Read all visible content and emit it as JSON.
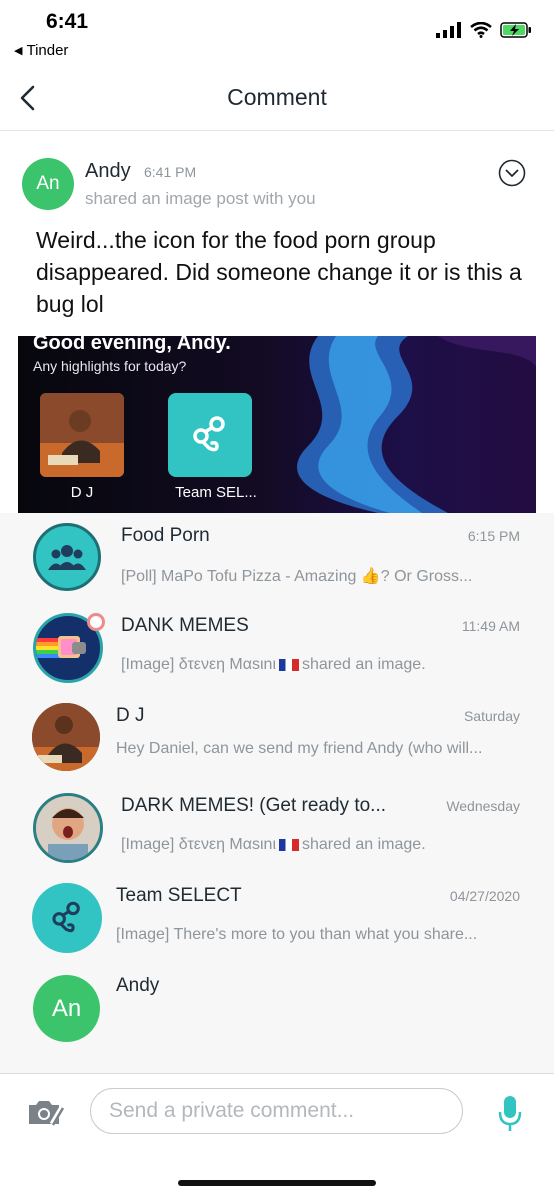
{
  "status_bar": {
    "time": "6:41",
    "back_app": "Tinder"
  },
  "nav": {
    "title": "Comment"
  },
  "post": {
    "avatar_initials": "An",
    "author": "Andy",
    "time": "6:41 PM",
    "subtitle": "shared an image post with you",
    "message": "Weird...the icon for the food porn group disappeared. Did someone change it or is this a bug lol"
  },
  "shared_image": {
    "greeting": "Good evening, Andy.",
    "subtitle": "Any highlights for today?",
    "items": [
      {
        "label": "D J"
      },
      {
        "label": "Team SEL..."
      }
    ]
  },
  "chats": [
    {
      "name": "Food Porn",
      "time": "6:15 PM",
      "preview": "[Poll] MaPo Tofu Pizza - Amazing",
      "preview_end": "? Or Gross...",
      "avatar_icon": "group-icon"
    },
    {
      "name": "DANK MEMES",
      "time": "11:49 AM",
      "preview": "[Image] δτενεη Μαsιnι",
      "preview_end": "shared an image.",
      "avatar_icon": "nyan-cat-image"
    },
    {
      "name": "D J",
      "time": "Saturday",
      "preview": "Hey Daniel, can we send my friend Andy (who will...",
      "avatar_icon": "person-photo"
    },
    {
      "name": "DARK MEMES! (Get ready to...",
      "time": "Wednesday",
      "preview": "[Image] δτενεη Μαsιnι",
      "preview_end": "shared an image.",
      "avatar_icon": "person-photo"
    },
    {
      "name": "Team SELECT",
      "time": "04/27/2020",
      "preview": "[Image] There's more to you than what you share...",
      "avatar_icon": "link-icon"
    },
    {
      "name": "Andy",
      "avatar_initials": "An"
    }
  ],
  "composer": {
    "placeholder": "Send a private comment..."
  },
  "colors": {
    "accent": "#31c4c2",
    "avatar_green": "#3cc46c"
  }
}
